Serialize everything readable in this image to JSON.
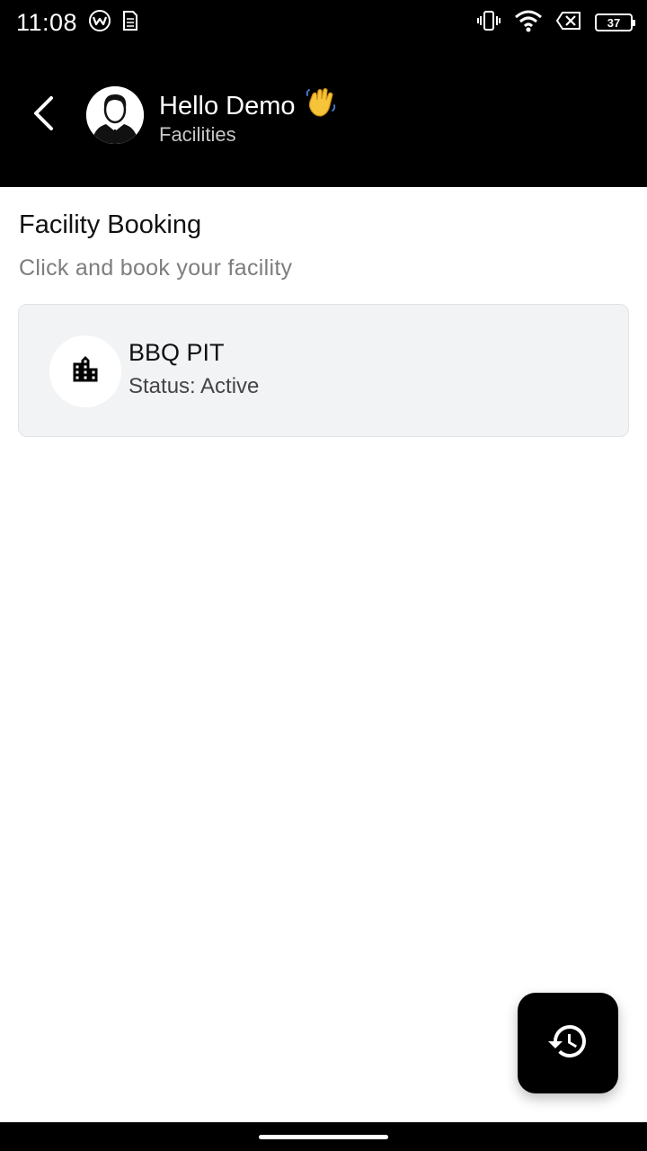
{
  "status_bar": {
    "time": "11:08",
    "battery": "37",
    "icons": [
      "vpn-icon",
      "sim-card-icon",
      "vibrate-icon",
      "wifi-icon",
      "no-signal-icon",
      "battery-icon"
    ]
  },
  "header": {
    "greeting": "Hello Demo",
    "emoji": "👋",
    "subtitle": "Facilities",
    "back_icon": "back-chevron-icon",
    "avatar": "user-avatar"
  },
  "main": {
    "title": "Facility Booking",
    "subtitle": "Click and book your facility",
    "facilities": [
      {
        "name": "BBQ PIT",
        "status": "Status: Active",
        "icon": "building-icon"
      }
    ]
  },
  "fab": {
    "icon": "history-icon"
  },
  "colors": {
    "app_bar": "#000000",
    "card_bg": "#f2f3f5",
    "card_border": "#e1e2e5",
    "subtitle_text": "#7d7d7d",
    "fab_bg": "#000000"
  }
}
